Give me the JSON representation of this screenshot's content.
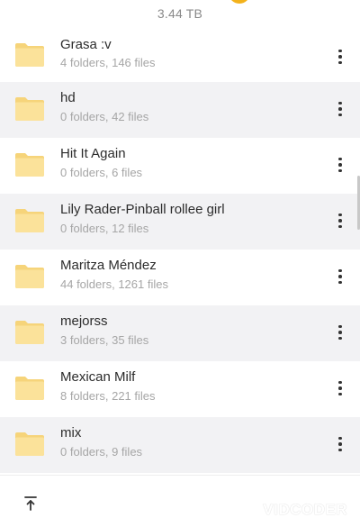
{
  "header": {
    "storage_label": "3.44 TB"
  },
  "folders": [
    {
      "name": "Grasa :v",
      "details": "4 folders, 146 files"
    },
    {
      "name": "hd",
      "details": "0 folders, 42 files"
    },
    {
      "name": "Hit It Again",
      "details": "0 folders, 6 files"
    },
    {
      "name": "Lily Rader-Pinball rollee girl",
      "details": "0 folders, 12 files"
    },
    {
      "name": "Maritza Méndez",
      "details": "44 folders, 1261 files"
    },
    {
      "name": "mejorss",
      "details": "3 folders, 35 files"
    },
    {
      "name": "Mexican Milf",
      "details": "8 folders, 221 files"
    },
    {
      "name": "mix",
      "details": "0 folders, 9 files"
    }
  ],
  "bottom_bar": {
    "watermark": "VIDCODER"
  },
  "icons": {
    "folder": "folder-icon",
    "menu": "more-vertical-icon",
    "scroll_to_top": "arrow-up-to-line-icon"
  },
  "colors": {
    "folder_fill": "#FBE29A",
    "folder_tab": "#F6D47A",
    "alt_row_bg": "#F2F2F4",
    "accent_badge": "#F3B21B"
  }
}
